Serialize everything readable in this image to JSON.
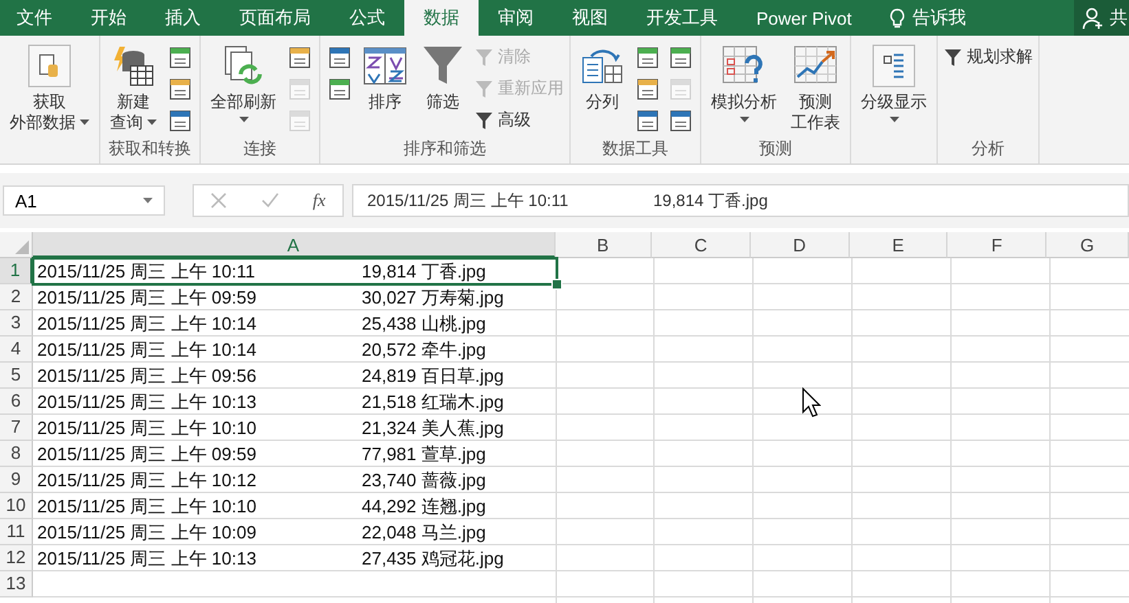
{
  "tabs": [
    {
      "label": "文件",
      "selected": false
    },
    {
      "label": "开始",
      "selected": false
    },
    {
      "label": "插入",
      "selected": false
    },
    {
      "label": "页面布局",
      "selected": false
    },
    {
      "label": "公式",
      "selected": false
    },
    {
      "label": "数据",
      "selected": true
    },
    {
      "label": "审阅",
      "selected": false
    },
    {
      "label": "视图",
      "selected": false
    },
    {
      "label": "开发工具",
      "selected": false
    },
    {
      "label": "Power Pivot",
      "selected": false
    }
  ],
  "tell_me": "告诉我",
  "share": "共",
  "ribbon_groups": [
    {
      "items": [
        {
          "kind": "large",
          "lines": [
            "获取",
            "外部数据"
          ],
          "dropdown": true
        }
      ]
    },
    {
      "label": "获取和转换",
      "items": [
        {
          "kind": "large",
          "lines": [
            "新建",
            "查询"
          ],
          "dropdown": true
        },
        {
          "kind": "icon_stack",
          "disabled": [
            false,
            false,
            false
          ]
        }
      ]
    },
    {
      "label": "连接",
      "items": [
        {
          "kind": "large",
          "lines": [
            "全部刷新"
          ],
          "dropdown": true
        },
        {
          "kind": "icon_stack",
          "disabled": [
            false,
            true,
            true
          ]
        }
      ]
    },
    {
      "label": "排序和筛选",
      "items": [
        {
          "kind": "icon_stack",
          "disabled": [
            false,
            false
          ]
        },
        {
          "kind": "large",
          "lines": [
            "排序"
          ],
          "dropdown": false
        },
        {
          "kind": "large",
          "lines": [
            "筛选"
          ],
          "dropdown": false
        },
        {
          "kind": "small_list",
          "buttons": [
            {
              "label": "清除",
              "disabled": true
            },
            {
              "label": "重新应用",
              "disabled": true
            },
            {
              "label": "高级",
              "disabled": false
            }
          ]
        }
      ]
    },
    {
      "label": "数据工具",
      "items": [
        {
          "kind": "large",
          "lines": [
            "分列"
          ],
          "dropdown": false
        },
        {
          "kind": "icon_stack",
          "disabled": [
            false,
            false,
            false
          ]
        },
        {
          "kind": "icon_stack",
          "disabled": [
            false,
            true,
            false
          ]
        }
      ]
    },
    {
      "label": "预测",
      "items": [
        {
          "kind": "large",
          "lines": [
            "模拟分析"
          ],
          "dropdown": true
        },
        {
          "kind": "large",
          "lines": [
            "预测",
            "工作表"
          ],
          "dropdown": false
        }
      ]
    },
    {
      "items": [
        {
          "kind": "large",
          "lines": [
            "分级显示"
          ],
          "dropdown": true
        }
      ]
    },
    {
      "label": "分析",
      "items": [
        {
          "kind": "small_list",
          "buttons": [
            {
              "label": "规划求解",
              "disabled": false
            }
          ]
        }
      ]
    }
  ],
  "name_box": "A1",
  "function_label": "fx",
  "formula": {
    "time": "2015/11/25 周三  上午 10:11",
    "file": "19,814 丁香.jpg"
  },
  "columns": [
    {
      "label": "A",
      "selected": true
    },
    {
      "label": "B",
      "selected": false
    },
    {
      "label": "C",
      "selected": false
    },
    {
      "label": "D",
      "selected": false
    },
    {
      "label": "E",
      "selected": false
    },
    {
      "label": "F",
      "selected": false
    },
    {
      "label": "G",
      "selected": false
    }
  ],
  "rows": [
    {
      "number": "1",
      "time": "2015/11/25 周三  上午 10:11",
      "file": "19,814 丁香.jpg",
      "selected": true
    },
    {
      "number": "2",
      "time": "2015/11/25 周三  上午 09:59",
      "file": "30,027 万寿菊.jpg",
      "selected": false
    },
    {
      "number": "3",
      "time": "2015/11/25 周三  上午 10:14",
      "file": "25,438 山桃.jpg",
      "selected": false
    },
    {
      "number": "4",
      "time": "2015/11/25 周三  上午 10:14",
      "file": "20,572 牵牛.jpg",
      "selected": false
    },
    {
      "number": "5",
      "time": "2015/11/25 周三  上午 09:56",
      "file": "24,819 百日草.jpg",
      "selected": false
    },
    {
      "number": "6",
      "time": "2015/11/25 周三  上午 10:13",
      "file": "21,518 红瑞木.jpg",
      "selected": false
    },
    {
      "number": "7",
      "time": "2015/11/25 周三  上午 10:10",
      "file": "21,324 美人蕉.jpg",
      "selected": false
    },
    {
      "number": "8",
      "time": "2015/11/25 周三  上午 09:59",
      "file": "77,981 萱草.jpg",
      "selected": false
    },
    {
      "number": "9",
      "time": "2015/11/25 周三  上午 10:12",
      "file": "23,740 蔷薇.jpg",
      "selected": false
    },
    {
      "number": "10",
      "time": "2015/11/25 周三  上午 10:10",
      "file": "44,292 连翘.jpg",
      "selected": false
    },
    {
      "number": "11",
      "time": "2015/11/25 周三  上午 10:09",
      "file": "22,048 马兰.jpg",
      "selected": false
    },
    {
      "number": "12",
      "time": "2015/11/25 周三  上午 10:13",
      "file": "27,435 鸡冠花.jpg",
      "selected": false
    },
    {
      "number": "13",
      "selected": false
    }
  ]
}
